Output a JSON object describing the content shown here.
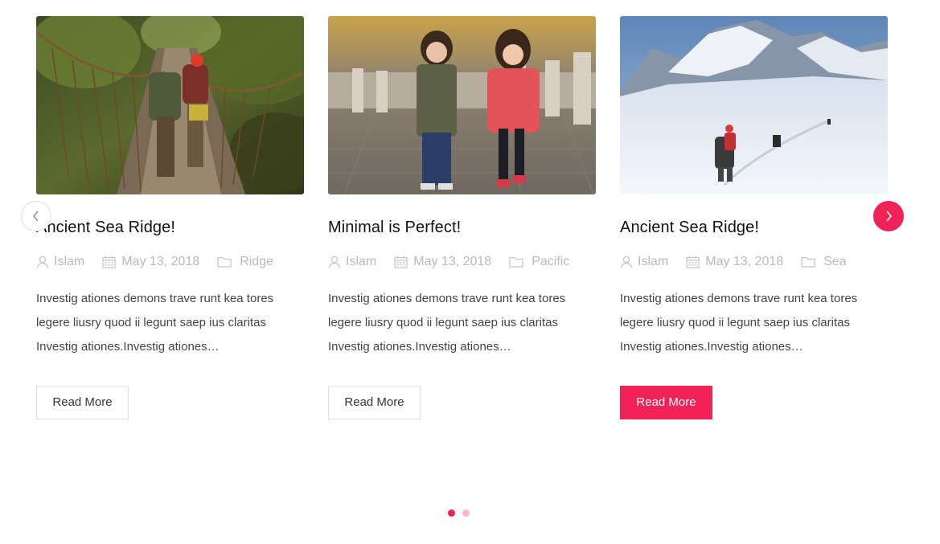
{
  "accent_color": "#f02257",
  "posts": [
    {
      "title": "Ancient Sea Ridge!",
      "author": "Islam",
      "date": "May 13, 2018",
      "category": "Ridge",
      "excerpt": "Investig ationes demons trave runt kea tores legere liusry quod ii legunt saep ius claritas Investig ationes.Investig ationes…",
      "button_label": "Read More",
      "image_alt": "hikers-crossing-rope-bridge"
    },
    {
      "title": "Minimal is Perfect!",
      "author": "Islam",
      "date": "May 13, 2018",
      "category": "Pacific",
      "excerpt": "Investig ationes demons trave runt kea tores legere liusry quod ii legunt saep ius claritas Investig ationes.Investig ationes…",
      "button_label": "Read More",
      "image_alt": "two-children-on-walkway"
    },
    {
      "title": "Ancient Sea Ridge!",
      "author": "Islam",
      "date": "May 13, 2018",
      "category": "Sea",
      "excerpt": "Investig ationes demons trave runt kea tores legere liusry quod ii legunt saep ius claritas Investig ationes.Investig ationes…",
      "button_label": "Read More",
      "image_alt": "hikers-in-snowy-mountains"
    }
  ],
  "navigation": {
    "prev_icon": "chevron-left-icon",
    "next_icon": "chevron-right-icon"
  },
  "pagination": {
    "total": 2,
    "active": 1
  }
}
